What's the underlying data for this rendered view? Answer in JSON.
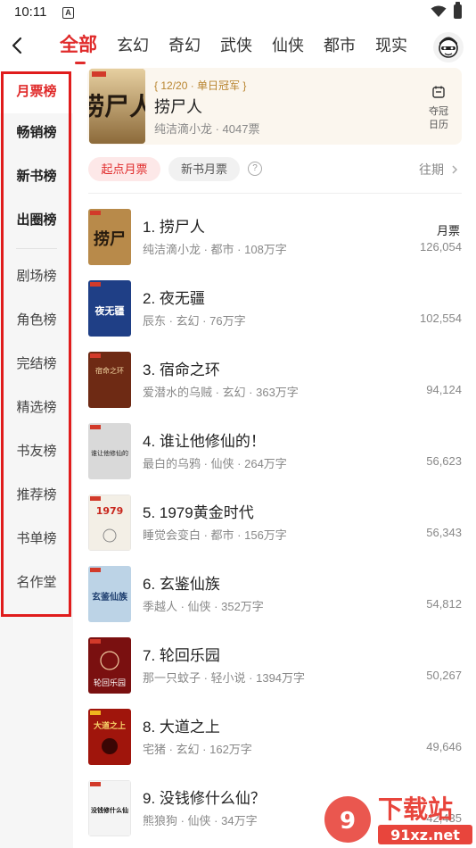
{
  "status_bar": {
    "time": "10:11",
    "notification_letter": "A"
  },
  "tabs": [
    "全部",
    "玄幻",
    "奇幻",
    "武侠",
    "仙侠",
    "都市",
    "现实"
  ],
  "active_tab": 0,
  "sidebar": {
    "items": [
      "月票榜",
      "畅销榜",
      "新书榜",
      "出圈榜",
      "剧场榜",
      "角色榜",
      "完结榜",
      "精选榜",
      "书友榜",
      "推荐榜",
      "书单榜",
      "名作堂"
    ],
    "active_index": 0
  },
  "champion": {
    "badge": "{ 12/20 · 单日冠军 }",
    "title": "捞尸人",
    "meta": "纯洁滴小龙 · 4047票",
    "calendar_label_1": "夺冠",
    "calendar_label_2": "日历",
    "cover_text": "捞尸人"
  },
  "filters": {
    "active": "起点月票",
    "other": "新书月票",
    "history": "往期",
    "help": "?"
  },
  "list_header": "月票",
  "books": [
    {
      "rank_title": "1. 捞尸人",
      "meta": "纯洁滴小龙 · 都市 · 108万字",
      "votes": "126,054",
      "cover_text": "捞尸",
      "cover_bg": "#b88a4a"
    },
    {
      "rank_title": "2. 夜无疆",
      "meta": "辰东 · 玄幻 · 76万字",
      "votes": "102,554",
      "cover_text": "夜无疆",
      "cover_bg": "#1f3f86"
    },
    {
      "rank_title": "3. 宿命之环",
      "meta": "爱潜水的乌贼 · 玄幻 · 363万字",
      "votes": "94,124",
      "cover_text": "宿命之环",
      "cover_bg": "#6e2a14"
    },
    {
      "rank_title": "4. 谁让他修仙的！",
      "meta": "最白的乌鸦 · 仙侠 · 264万字",
      "votes": "56,623",
      "cover_text": "谁让他修仙的",
      "cover_bg": "#d9d9d9"
    },
    {
      "rank_title": "5. 1979黄金时代",
      "meta": "睡觉会变白 · 都市 · 156万字",
      "votes": "56,343",
      "cover_text": "1979",
      "cover_bg": "#f3efe6"
    },
    {
      "rank_title": "6. 玄鉴仙族",
      "meta": "季越人 · 仙侠 · 352万字",
      "votes": "54,812",
      "cover_text": "玄鉴仙族",
      "cover_bg": "#bcd3e6"
    },
    {
      "rank_title": "7. 轮回乐园",
      "meta": "那一只蚊子 · 轻小说 · 1394万字",
      "votes": "50,267",
      "cover_text": "轮回乐园",
      "cover_bg": "#7a1010"
    },
    {
      "rank_title": "8. 大道之上",
      "meta": "宅猪 · 玄幻 · 162万字",
      "votes": "49,646",
      "cover_text": "大道之上",
      "cover_bg": "#a0150c"
    },
    {
      "rank_title": "9. 没钱修什么仙？",
      "meta": "熊狼狗 · 仙侠 · 34万字",
      "votes": "42,435",
      "cover_text": "没钱修什么仙",
      "cover_bg": "#f4f4f4"
    }
  ],
  "watermark": {
    "main": "下载站",
    "sub": "91xz.net"
  },
  "colors": {
    "accent": "#e02b2b",
    "gold": "#b8842e",
    "highlight_border": "#e01c1c"
  }
}
